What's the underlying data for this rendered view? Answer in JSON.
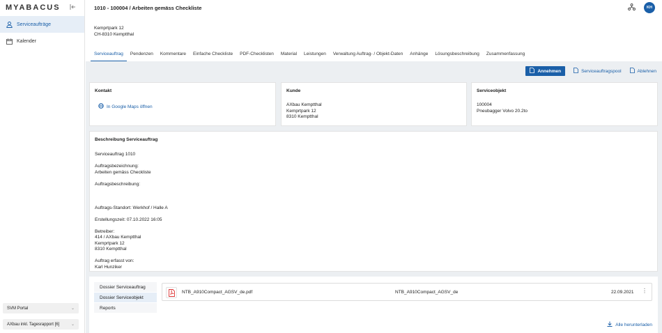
{
  "sidebar": {
    "logo": "MYABACUS",
    "items": [
      {
        "label": "Serviceaufträge",
        "active": true
      },
      {
        "label": "Kalender",
        "active": false
      }
    ],
    "selectors": [
      {
        "value": "SVM Portal"
      },
      {
        "value": "AXbau inkl. Tagesrapport [6]"
      }
    ]
  },
  "header": {
    "title": "1010 - 100004 / Arbeiten gemäss Checkliste",
    "avatar_initials": "KH"
  },
  "address": {
    "line1": "Kemprtpark 12",
    "line2": "CH-8310 Kemptthal"
  },
  "tabs": [
    {
      "label": "Serviceauftrag",
      "active": true
    },
    {
      "label": "Pendenzen"
    },
    {
      "label": "Kommentare"
    },
    {
      "label": "Einfache Checkliste"
    },
    {
      "label": "PDF-Checklisten"
    },
    {
      "label": "Material"
    },
    {
      "label": "Leistungen"
    },
    {
      "label": "Verwaltung Auftrag- / Objekt-Daten"
    },
    {
      "label": "Anhänge"
    },
    {
      "label": "Lösungsbeschreibung"
    },
    {
      "label": "Zusammenfassung"
    }
  ],
  "actions": {
    "accept": "Annehmen",
    "pool": "Serviceauftragspool",
    "reject": "Ablehnen"
  },
  "cards": {
    "kontakt": {
      "title": "Kontakt",
      "maps_link": "In Google Maps öffnen"
    },
    "kunde": {
      "title": "Kunde",
      "lines": [
        "AXbau Kemptthal",
        "Kemprtpark 12",
        "8310 Kemptthal"
      ]
    },
    "serviceobjekt": {
      "title": "Serviceobjekt",
      "lines": [
        "100004",
        "Pneubagger Volvo 20.2to"
      ]
    }
  },
  "description": {
    "title": "Beschreibung Serviceauftrag",
    "lines": [
      "Serviceauftrag 1010",
      "",
      "Auftragsbezeichnung:",
      "Arbeiten gemäss Checkliste",
      "",
      "Auftragsbeschreibung:",
      "",
      "",
      "",
      "Auftrags-Standort: Werkhof / Halle A",
      "",
      "Erstellungszeit: 07.10.2022 16:05",
      "",
      "Betreiber:",
      "414 / AXbau Kemptthal",
      "Kemprtpark 12",
      "8310 Kemptthal",
      "",
      "Auftrag erfasst von:",
      "Karl Hunziker"
    ]
  },
  "dossier": {
    "tabs": [
      {
        "label": "Dossier Serviceauftrag"
      },
      {
        "label": "Dossier Serviceobjekt",
        "active": true
      },
      {
        "label": "Reports"
      }
    ],
    "file": {
      "filename": "NTB_A910Compact_AGSV_de.pdf",
      "title": "NTB_A910Compact_AGSV_de",
      "date": "22.09.2021"
    },
    "download_all": "Alle herunterladen"
  },
  "colors": {
    "accent": "#1a5fa8",
    "background": "#eceff2"
  }
}
